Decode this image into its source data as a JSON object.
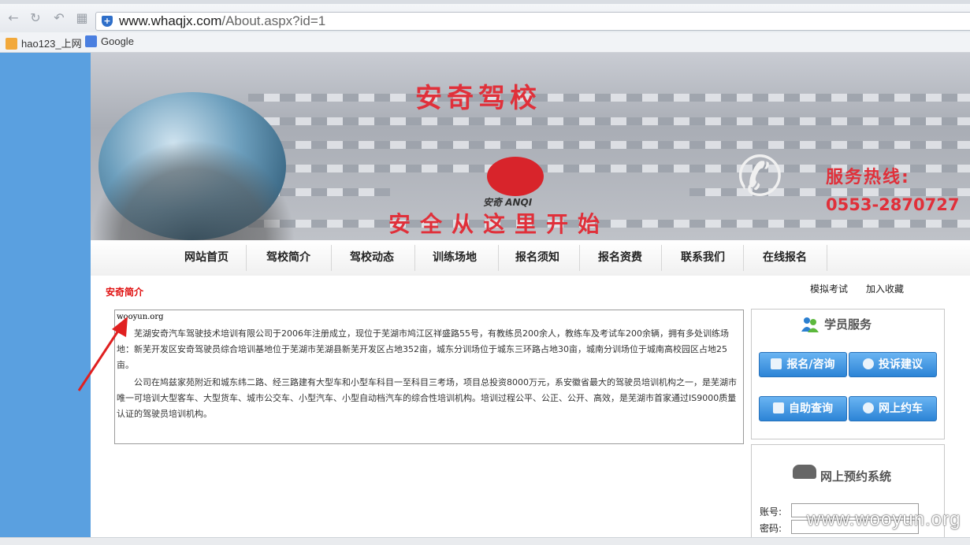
{
  "browser": {
    "url_host": "www.whaqjx.com",
    "url_path": "/About.aspx?id=1",
    "bookmarks": [
      {
        "label": "hao123_上网"
      },
      {
        "label": "Google"
      }
    ]
  },
  "banner": {
    "school_name": "安奇驾校",
    "slogan": "安全从这里开始",
    "logo_text": "安奇 ANQI",
    "hotline_label": "服务热线:",
    "hotline_number": "0553-2870727"
  },
  "nav": {
    "items": [
      {
        "label": "网站首页"
      },
      {
        "label": "驾校简介"
      },
      {
        "label": "驾校动态"
      },
      {
        "label": "训练场地"
      },
      {
        "label": "报名须知"
      },
      {
        "label": "报名资费"
      },
      {
        "label": "联系我们"
      },
      {
        "label": "在线报名"
      }
    ]
  },
  "content": {
    "section_title": "安奇简介",
    "top_links": [
      "模拟考试",
      "加入收藏"
    ],
    "small_watermark": "wooyun.org",
    "paragraph1": "芜湖安奇汽车驾驶技术培训有限公司于2006年注册成立，现位于芜湖市鸠江区祥盛路55号，有教练员200余人，教练车及考试车200余辆，拥有多处训练场地：新芜开发区安奇驾驶员综合培训基地位于芜湖市芜湖县新芜开发区占地352亩，城东分训场位于城东三环路占地30亩，城南分训场位于城南高校园区占地25亩。",
    "paragraph2": "公司在鸠兹家苑附近和城东纬二路、经三路建有大型车和小型车科目一至科目三考场，项目总投资8000万元，系安徽省最大的驾驶员培训机构之一，是芜湖市唯一可培训大型客车、大型货车、城市公交车、小型汽车、小型自动档汽车的综合性培训机构。培训过程公平、公正、公开、高效，是芜湖市首家通过IS9000质量认证的驾驶员培训机构。"
  },
  "service": {
    "title": "学员服务",
    "buttons": [
      {
        "label": "报名/咨询"
      },
      {
        "label": "投诉建议"
      },
      {
        "label": "自助查询"
      },
      {
        "label": "网上约车"
      }
    ]
  },
  "booking": {
    "title": "网上预约系统",
    "account_label": "账号:",
    "password_label": "密码:",
    "account_value": "",
    "password_value": ""
  },
  "watermark": "www.wooyun.org",
  "colors": {
    "brand_red": "#e0303a",
    "side_blue": "#5aa0e0",
    "button_blue": "#2c84d6"
  }
}
